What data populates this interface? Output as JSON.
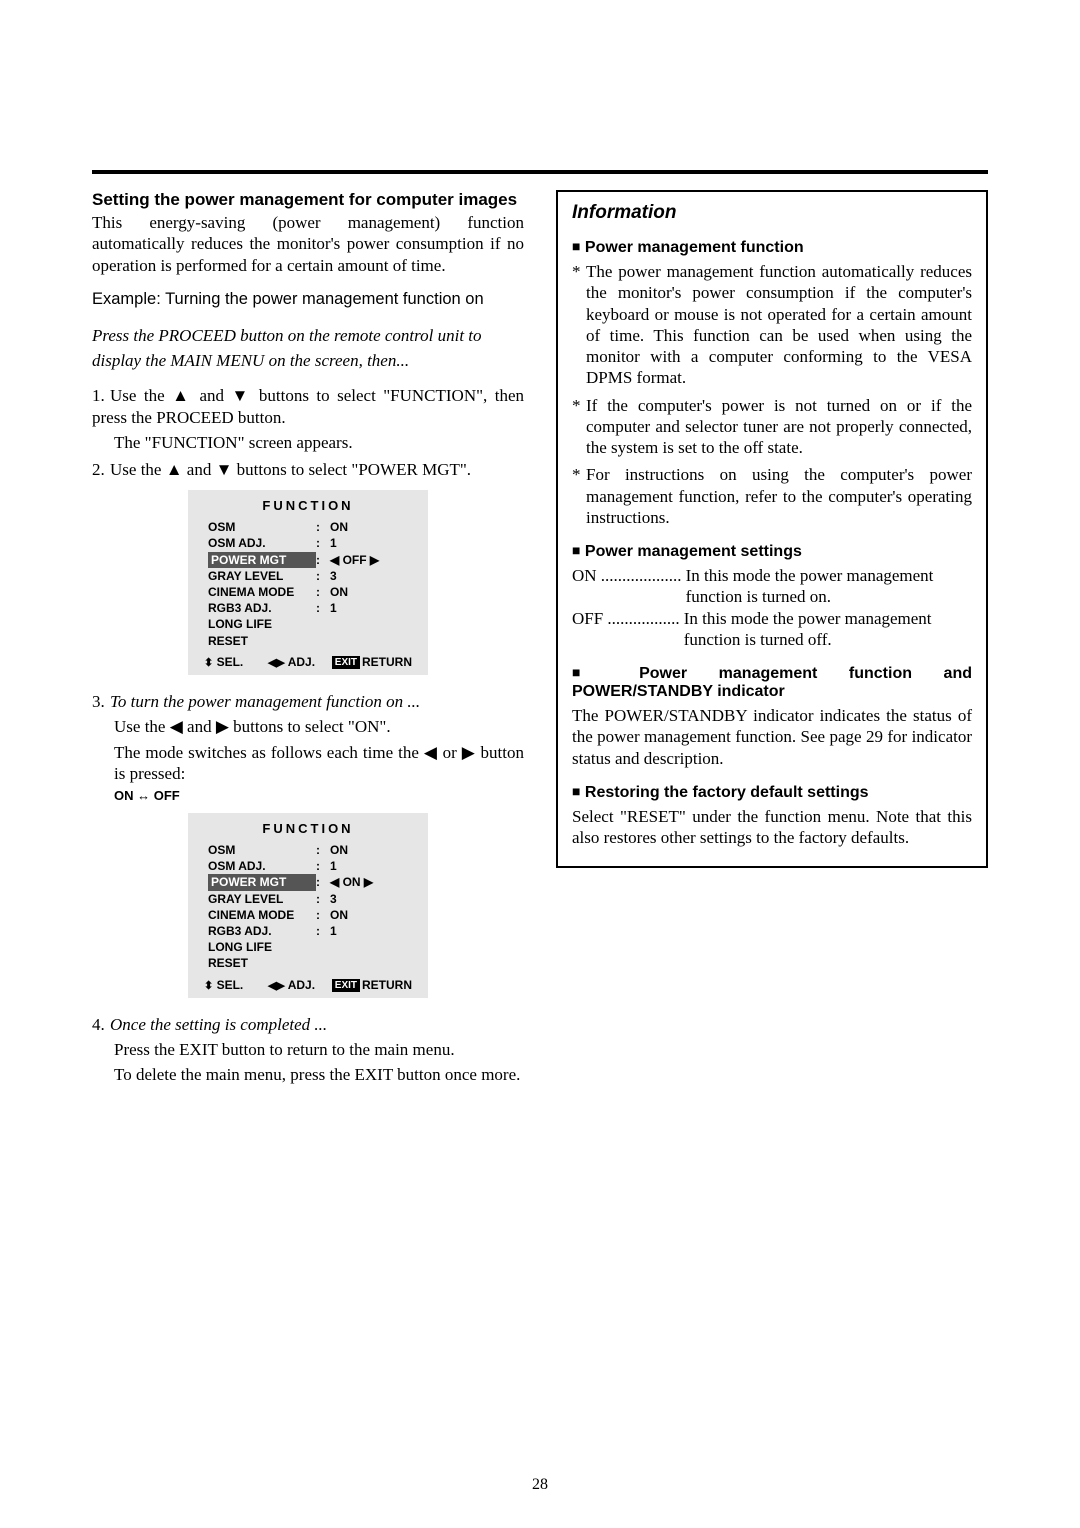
{
  "left": {
    "heading": "Setting the power management for computer images",
    "intro": "This energy-saving (power management) function automatically reduces the monitor's power consumption if no operation is performed for a certain amount of time.",
    "example": "Example: Turning the power management function on",
    "press_line1": "Press the PROCEED button on the remote control unit to",
    "press_line2": "display the MAIN MENU on the screen, then...",
    "step1a": "Use the ▲ and ▼ buttons to select \"FUNCTION\", then press the PROCEED button.",
    "step1b": "The \"FUNCTION\" screen appears.",
    "step2": "Use the ▲ and ▼ buttons to select \"POWER MGT\".",
    "step3_it": "To turn the power management function on ...",
    "step3a": "Use the ◀ and ▶ buttons to select \"ON\".",
    "step3b": "The mode switches as follows each time the ◀ or ▶ button is pressed:",
    "toggle": "ON ↔ OFF",
    "step4_it": "Once the setting is completed ...",
    "step4a": "Press the EXIT button to return to the main menu.",
    "step4b": "To delete the main menu, press the EXIT button once more."
  },
  "menu_a": {
    "title": "FUNCTION",
    "rows": [
      {
        "label": "OSM",
        "val": "ON"
      },
      {
        "label": "OSM ADJ.",
        "val": "1"
      },
      {
        "label": "POWER MGT",
        "val": "◀ OFF ▶",
        "hi": true
      },
      {
        "label": "GRAY LEVEL",
        "val": "3"
      },
      {
        "label": "CINEMA MODE",
        "val": "ON"
      },
      {
        "label": "RGB3 ADJ.",
        "val": "1"
      },
      {
        "label": "LONG LIFE",
        "val": ""
      },
      {
        "label": "RESET",
        "val": ""
      }
    ],
    "sel": "SEL.",
    "adj": "ADJ.",
    "ret": "RETURN",
    "exit": "EXIT"
  },
  "menu_b": {
    "title": "FUNCTION",
    "rows": [
      {
        "label": "OSM",
        "val": "ON"
      },
      {
        "label": "OSM ADJ.",
        "val": "1"
      },
      {
        "label": "POWER MGT",
        "val": "◀ ON ▶",
        "hi": true
      },
      {
        "label": "GRAY LEVEL",
        "val": "3"
      },
      {
        "label": "CINEMA MODE",
        "val": "ON"
      },
      {
        "label": "RGB3 ADJ.",
        "val": "1"
      },
      {
        "label": "LONG LIFE",
        "val": ""
      },
      {
        "label": "RESET",
        "val": ""
      }
    ],
    "sel": "SEL.",
    "adj": "ADJ.",
    "ret": "RETURN",
    "exit": "EXIT"
  },
  "info": {
    "title": "Information",
    "h1": "Power management function",
    "b1": "The power management function automatically reduces the monitor's power consumption if the computer's keyboard or mouse is not operated for a certain amount of time. This function can be used when using the monitor with a computer conforming to the VESA DPMS format.",
    "b2": "If the computer's power is not turned on or if the computer and selector tuner are not properly connected, the system is set to the off state.",
    "b3": "For instructions on using the computer's power management function, refer to the computer's operating instructions.",
    "h2": "Power management settings",
    "on_dots": "ON ...................",
    "on_desc": "In this mode the power management function is turned on.",
    "off_dots": "OFF .................",
    "off_desc": "In this mode the power management function is turned off.",
    "h3": "Power management function and POWER/STANDBY indicator",
    "p3": "The POWER/STANDBY indicator indicates the status of the power management function. See page 29 for indicator status and description.",
    "h4": "Restoring the factory default settings",
    "p4": "Select \"RESET\" under the function menu. Note that this also restores other settings to the factory defaults."
  },
  "page_number": "28"
}
